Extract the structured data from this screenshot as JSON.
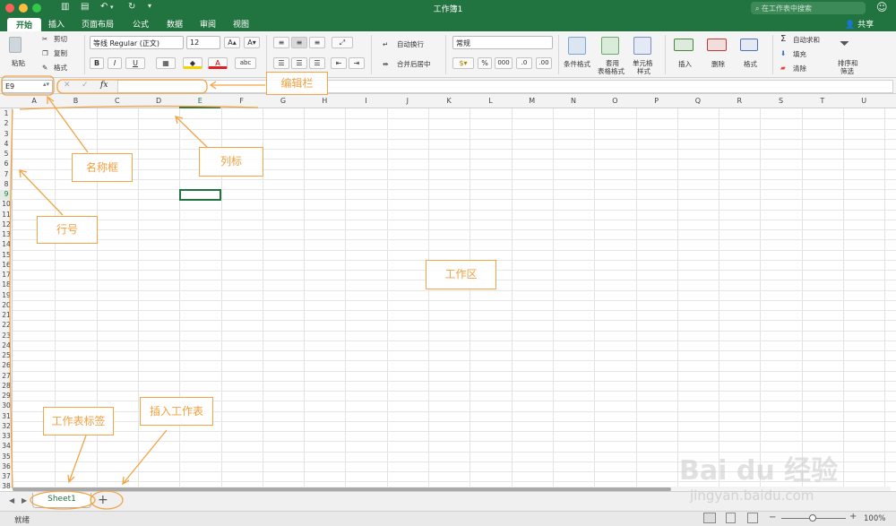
{
  "window": {
    "title": "工作簿1",
    "search_placeholder": "在工作表中搜索",
    "share_label": "共享"
  },
  "tabs": [
    "开始",
    "插入",
    "页面布局",
    "公式",
    "数据",
    "审阅",
    "视图"
  ],
  "ribbon": {
    "paste": "粘贴",
    "cut": "剪切",
    "copy": "复制",
    "format_painter": "格式",
    "font_name": "等线 Regular (正文)",
    "font_size": "12",
    "bold": "B",
    "italic": "I",
    "underline": "U",
    "wrap_text": "自动换行",
    "merge_center": "合并后居中",
    "number_format": "常规",
    "percent": "%",
    "comma": "000",
    "cond_format": "条件格式",
    "table_format_1": "套用",
    "table_format_2": "表格格式",
    "cell_style_1": "单元格",
    "cell_style_2": "样式",
    "insert": "插入",
    "delete": "删除",
    "format": "格式",
    "autosum": "自动求和",
    "fill": "填充",
    "clear": "清除",
    "sort_filter_1": "排序和",
    "sort_filter_2": "筛选"
  },
  "formula_bar": {
    "name_box": "E9",
    "fx": "fx",
    "cancel": "✕",
    "confirm": "✓",
    "value": ""
  },
  "columns": [
    "A",
    "B",
    "C",
    "D",
    "E",
    "F",
    "G",
    "H",
    "I",
    "J",
    "K",
    "L",
    "M",
    "N",
    "O",
    "P",
    "Q",
    "R",
    "S",
    "T",
    "U"
  ],
  "rows": [
    "1",
    "2",
    "3",
    "4",
    "5",
    "6",
    "7",
    "8",
    "9",
    "10",
    "11",
    "12",
    "13",
    "14",
    "15",
    "16",
    "17",
    "18",
    "19",
    "20",
    "21",
    "22",
    "23",
    "24",
    "25",
    "26",
    "27",
    "28",
    "29",
    "30",
    "31",
    "32",
    "33",
    "34",
    "35",
    "36",
    "37",
    "38"
  ],
  "selected_cell": "E9",
  "sheets": {
    "tabs": [
      "Sheet1"
    ],
    "add": "+"
  },
  "status": {
    "ready": "就绪",
    "zoom": "100%"
  },
  "annotations": {
    "formula_bar": "编辑栏",
    "name_box": "名称框",
    "column_header": "列标",
    "row_header": "行号",
    "work_area": "工作区",
    "sheet_tab": "工作表标签",
    "insert_sheet": "插入工作表"
  },
  "watermark": {
    "brand": "Bai du 经验",
    "url": "jingyan.baidu.com"
  },
  "colors": {
    "accent": "#21733f",
    "annotation": "#f0a040"
  }
}
